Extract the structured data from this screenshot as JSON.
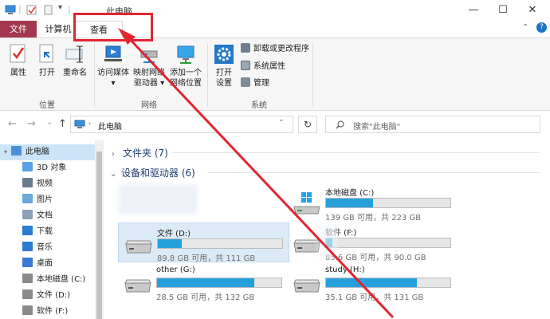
{
  "window": {
    "title": "此电脑",
    "controls": {
      "minimize": "—",
      "maximize": "☐",
      "close": "✕"
    }
  },
  "tabs": {
    "file": "文件",
    "computer": "计算机",
    "view": "查看"
  },
  "ribbon": {
    "location_group": "位置",
    "network_group": "网络",
    "system_group": "系统",
    "properties": "属性",
    "open": "打开",
    "rename": "重命名",
    "access_media_1": "访问媒体",
    "access_media_2": "▾",
    "map_drive_1": "映射网络",
    "map_drive_2": "驱动器 ▾",
    "add_location_1": "添加一个",
    "add_location_2": "网络位置",
    "open_settings_1": "打开",
    "open_settings_2": "设置",
    "uninstall": "卸载或更改程序",
    "system_props": "系统属性",
    "manage": "管理"
  },
  "nav": {
    "back": "←",
    "forward": "→",
    "recent": "⌄",
    "up": "↑",
    "address": "此电脑",
    "refresh": "↻",
    "search_placeholder": "搜索\"此电脑\""
  },
  "navpane": [
    {
      "label": "此电脑",
      "caret": "▾",
      "color": "#4a90d9"
    },
    {
      "label": "3D 对象",
      "caret": "",
      "color": "#5aa0e6"
    },
    {
      "label": "视频",
      "caret": "",
      "color": "#6a7c8f"
    },
    {
      "label": "图片",
      "caret": "",
      "color": "#6aa8d8"
    },
    {
      "label": "文档",
      "caret": "",
      "color": "#8aa0b8"
    },
    {
      "label": "下载",
      "caret": "",
      "color": "#2b7cd3"
    },
    {
      "label": "音乐",
      "caret": "",
      "color": "#2b7cd3"
    },
    {
      "label": "桌面",
      "caret": "",
      "color": "#3a7bd5"
    },
    {
      "label": "本地磁盘 (C:)",
      "caret": "",
      "color": "#8a8a8a"
    },
    {
      "label": "文件 (D:)",
      "caret": "",
      "color": "#8a8a8a"
    },
    {
      "label": "软件 (F:)",
      "caret": "",
      "color": "#8a8a8a"
    }
  ],
  "content": {
    "folders_header": "文件夹 (7)",
    "devices_header": "设备和驱动器 (6)",
    "drives": [
      {
        "name": "本地磁盘 (C:)",
        "info": "139 GB 可用，共 223 GB",
        "used_fraction": 0.38,
        "selected": false
      },
      {
        "name": "文件 (D:)",
        "info": "89.8 GB 可用，共 111 GB",
        "used_fraction": 0.19,
        "selected": true
      },
      {
        "name": "软件 (F:)",
        "info": "85.6 GB 可用，共 90.0 GB",
        "used_fraction": 0.05,
        "selected": false
      },
      {
        "name": "other (G:)",
        "info": "28.5 GB 可用，共 132 GB",
        "used_fraction": 0.78,
        "selected": false
      },
      {
        "name": "study (H:)",
        "info": "35.1 GB 可用，共 131 GB",
        "used_fraction": 0.73,
        "selected": false
      }
    ]
  },
  "colors": {
    "file_tab": "#a2374e",
    "drive_bar": "#26a0da",
    "annotation_red": "#e32431"
  }
}
